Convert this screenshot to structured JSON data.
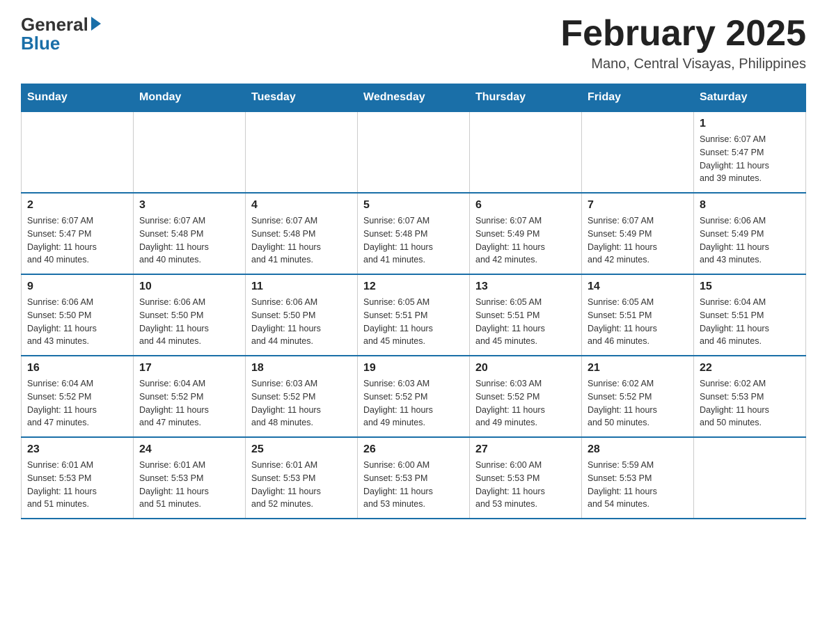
{
  "logo": {
    "general": "General",
    "blue": "Blue"
  },
  "header": {
    "month_title": "February 2025",
    "location": "Mano, Central Visayas, Philippines"
  },
  "days_of_week": [
    "Sunday",
    "Monday",
    "Tuesday",
    "Wednesday",
    "Thursday",
    "Friday",
    "Saturday"
  ],
  "weeks": [
    [
      {
        "day": "",
        "info": ""
      },
      {
        "day": "",
        "info": ""
      },
      {
        "day": "",
        "info": ""
      },
      {
        "day": "",
        "info": ""
      },
      {
        "day": "",
        "info": ""
      },
      {
        "day": "",
        "info": ""
      },
      {
        "day": "1",
        "info": "Sunrise: 6:07 AM\nSunset: 5:47 PM\nDaylight: 11 hours\nand 39 minutes."
      }
    ],
    [
      {
        "day": "2",
        "info": "Sunrise: 6:07 AM\nSunset: 5:47 PM\nDaylight: 11 hours\nand 40 minutes."
      },
      {
        "day": "3",
        "info": "Sunrise: 6:07 AM\nSunset: 5:48 PM\nDaylight: 11 hours\nand 40 minutes."
      },
      {
        "day": "4",
        "info": "Sunrise: 6:07 AM\nSunset: 5:48 PM\nDaylight: 11 hours\nand 41 minutes."
      },
      {
        "day": "5",
        "info": "Sunrise: 6:07 AM\nSunset: 5:48 PM\nDaylight: 11 hours\nand 41 minutes."
      },
      {
        "day": "6",
        "info": "Sunrise: 6:07 AM\nSunset: 5:49 PM\nDaylight: 11 hours\nand 42 minutes."
      },
      {
        "day": "7",
        "info": "Sunrise: 6:07 AM\nSunset: 5:49 PM\nDaylight: 11 hours\nand 42 minutes."
      },
      {
        "day": "8",
        "info": "Sunrise: 6:06 AM\nSunset: 5:49 PM\nDaylight: 11 hours\nand 43 minutes."
      }
    ],
    [
      {
        "day": "9",
        "info": "Sunrise: 6:06 AM\nSunset: 5:50 PM\nDaylight: 11 hours\nand 43 minutes."
      },
      {
        "day": "10",
        "info": "Sunrise: 6:06 AM\nSunset: 5:50 PM\nDaylight: 11 hours\nand 44 minutes."
      },
      {
        "day": "11",
        "info": "Sunrise: 6:06 AM\nSunset: 5:50 PM\nDaylight: 11 hours\nand 44 minutes."
      },
      {
        "day": "12",
        "info": "Sunrise: 6:05 AM\nSunset: 5:51 PM\nDaylight: 11 hours\nand 45 minutes."
      },
      {
        "day": "13",
        "info": "Sunrise: 6:05 AM\nSunset: 5:51 PM\nDaylight: 11 hours\nand 45 minutes."
      },
      {
        "day": "14",
        "info": "Sunrise: 6:05 AM\nSunset: 5:51 PM\nDaylight: 11 hours\nand 46 minutes."
      },
      {
        "day": "15",
        "info": "Sunrise: 6:04 AM\nSunset: 5:51 PM\nDaylight: 11 hours\nand 46 minutes."
      }
    ],
    [
      {
        "day": "16",
        "info": "Sunrise: 6:04 AM\nSunset: 5:52 PM\nDaylight: 11 hours\nand 47 minutes."
      },
      {
        "day": "17",
        "info": "Sunrise: 6:04 AM\nSunset: 5:52 PM\nDaylight: 11 hours\nand 47 minutes."
      },
      {
        "day": "18",
        "info": "Sunrise: 6:03 AM\nSunset: 5:52 PM\nDaylight: 11 hours\nand 48 minutes."
      },
      {
        "day": "19",
        "info": "Sunrise: 6:03 AM\nSunset: 5:52 PM\nDaylight: 11 hours\nand 49 minutes."
      },
      {
        "day": "20",
        "info": "Sunrise: 6:03 AM\nSunset: 5:52 PM\nDaylight: 11 hours\nand 49 minutes."
      },
      {
        "day": "21",
        "info": "Sunrise: 6:02 AM\nSunset: 5:52 PM\nDaylight: 11 hours\nand 50 minutes."
      },
      {
        "day": "22",
        "info": "Sunrise: 6:02 AM\nSunset: 5:53 PM\nDaylight: 11 hours\nand 50 minutes."
      }
    ],
    [
      {
        "day": "23",
        "info": "Sunrise: 6:01 AM\nSunset: 5:53 PM\nDaylight: 11 hours\nand 51 minutes."
      },
      {
        "day": "24",
        "info": "Sunrise: 6:01 AM\nSunset: 5:53 PM\nDaylight: 11 hours\nand 51 minutes."
      },
      {
        "day": "25",
        "info": "Sunrise: 6:01 AM\nSunset: 5:53 PM\nDaylight: 11 hours\nand 52 minutes."
      },
      {
        "day": "26",
        "info": "Sunrise: 6:00 AM\nSunset: 5:53 PM\nDaylight: 11 hours\nand 53 minutes."
      },
      {
        "day": "27",
        "info": "Sunrise: 6:00 AM\nSunset: 5:53 PM\nDaylight: 11 hours\nand 53 minutes."
      },
      {
        "day": "28",
        "info": "Sunrise: 5:59 AM\nSunset: 5:53 PM\nDaylight: 11 hours\nand 54 minutes."
      },
      {
        "day": "",
        "info": ""
      }
    ]
  ]
}
